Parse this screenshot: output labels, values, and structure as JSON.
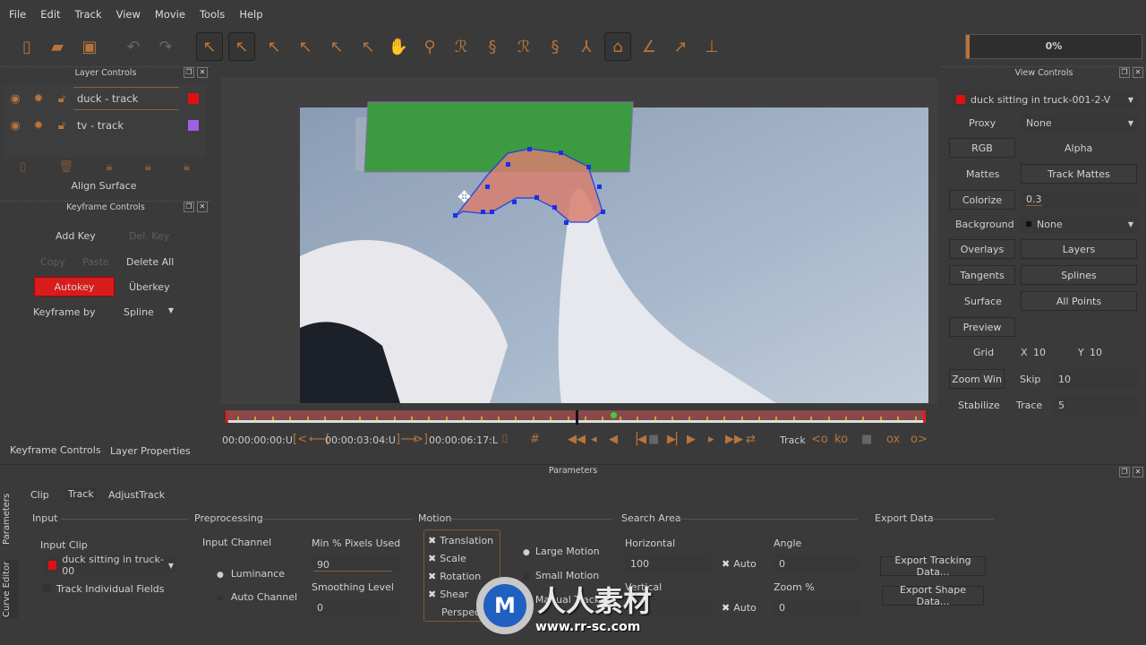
{
  "menu": [
    "File",
    "Edit",
    "Track",
    "View",
    "Movie",
    "Tools",
    "Help"
  ],
  "toolbar": {
    "icons": [
      "new-file-icon",
      "open-folder-icon",
      "save-icon",
      "undo-icon",
      "redo-icon",
      "select-icon",
      "select-b-icon",
      "select-i-icon",
      "select-e-icon",
      "select-a-icon",
      "add-point-icon",
      "pan-hand-icon",
      "zoom-icon",
      "spline-x-icon",
      "spline-add-x-icon",
      "spline-b-icon",
      "spline-add-b-icon",
      "transform-icon",
      "lock-surface-icon",
      "angle-icon",
      "arrow-icon",
      "axis-icon"
    ],
    "progress_label": "0%",
    "progress": 0
  },
  "layer_controls": {
    "title": "Layer Controls",
    "layers": [
      {
        "name": "duck - track",
        "color": "#e01010"
      },
      {
        "name": "tv - track",
        "color": "#a060e8"
      }
    ],
    "align_surface": "Align Surface"
  },
  "keyframe_controls": {
    "title": "Keyframe Controls",
    "add_key": "Add Key",
    "del_key": "Del. Key",
    "copy": "Copy",
    "paste": "Paste",
    "delete_all": "Delete All",
    "autokey": "Autokey",
    "uberkey": "Überkey",
    "keyframe_by_label": "Keyframe by",
    "keyframe_by_value": "Spline"
  },
  "left_tabs": [
    "Keyframe Controls",
    "Layer Properties"
  ],
  "timeline": {
    "in_time": "00:00:00:00:U",
    "current_time": "00:00:03:04:U",
    "out_time": "00:00:06:17:L",
    "track_label": "Track",
    "playhead": 0.5,
    "key_position": 0.55
  },
  "view_controls": {
    "title": "View Controls",
    "clip": "duck sitting in truck-001-2-V",
    "clip_color": "#e01010",
    "proxy_label": "Proxy",
    "proxy_value": "None",
    "rgb": "RGB",
    "alpha": "Alpha",
    "mattes": "Mattes",
    "track_mattes": "Track Mattes",
    "colorize": "Colorize",
    "colorize_value": "0.3",
    "background_label": "Background",
    "background_value": "None",
    "overlays": "Overlays",
    "layers": "Layers",
    "tangents": "Tangents",
    "splines": "Splines",
    "surface": "Surface",
    "all_points": "All Points",
    "preview": "Preview",
    "grid": "Grid",
    "grid_x_label": "X",
    "grid_x": "10",
    "grid_y_label": "Y",
    "grid_y": "10",
    "zoom_win": "Zoom Win",
    "skip": "Skip",
    "skip_value": "10",
    "stabilize": "Stabilize",
    "trace": "Trace",
    "trace_value": "5"
  },
  "parameters": {
    "title": "Parameters",
    "side_tabs": [
      "Parameters",
      "Curve Editor"
    ],
    "tabs": [
      "Clip",
      "Track",
      "AdjustTrack"
    ],
    "input": {
      "title": "Input",
      "input_clip_label": "Input Clip",
      "input_clip": "duck sitting in truck-00",
      "track_fields": "Track Individual Fields"
    },
    "preprocessing": {
      "title": "Preprocessing",
      "input_channel": "Input Channel",
      "luminance": "Luminance",
      "auto_channel": "Auto Channel",
      "min_pixels_label": "Min % Pixels Used",
      "min_pixels": "90",
      "smoothing_label": "Smoothing Level",
      "smoothing": "0"
    },
    "motion": {
      "title": "Motion",
      "options": [
        "Translation",
        "Scale",
        "Rotation",
        "Shear",
        "Perspective"
      ],
      "large": "Large Motion",
      "small": "Small Motion",
      "manual": "Manual Track"
    },
    "search_area": {
      "title": "Search Area",
      "horizontal": "Horizontal",
      "horizontal_value": "100",
      "vertical": "Vertical",
      "auto": "Auto",
      "angle": "Angle",
      "angle_value": "0",
      "zoom": "Zoom %",
      "zoom_value": "0"
    },
    "export": {
      "title": "Export Data",
      "tracking": "Export Tracking Data...",
      "shape": "Export Shape Data..."
    }
  },
  "watermark": {
    "text": "人人素材",
    "url": "www.rr-sc.com"
  }
}
